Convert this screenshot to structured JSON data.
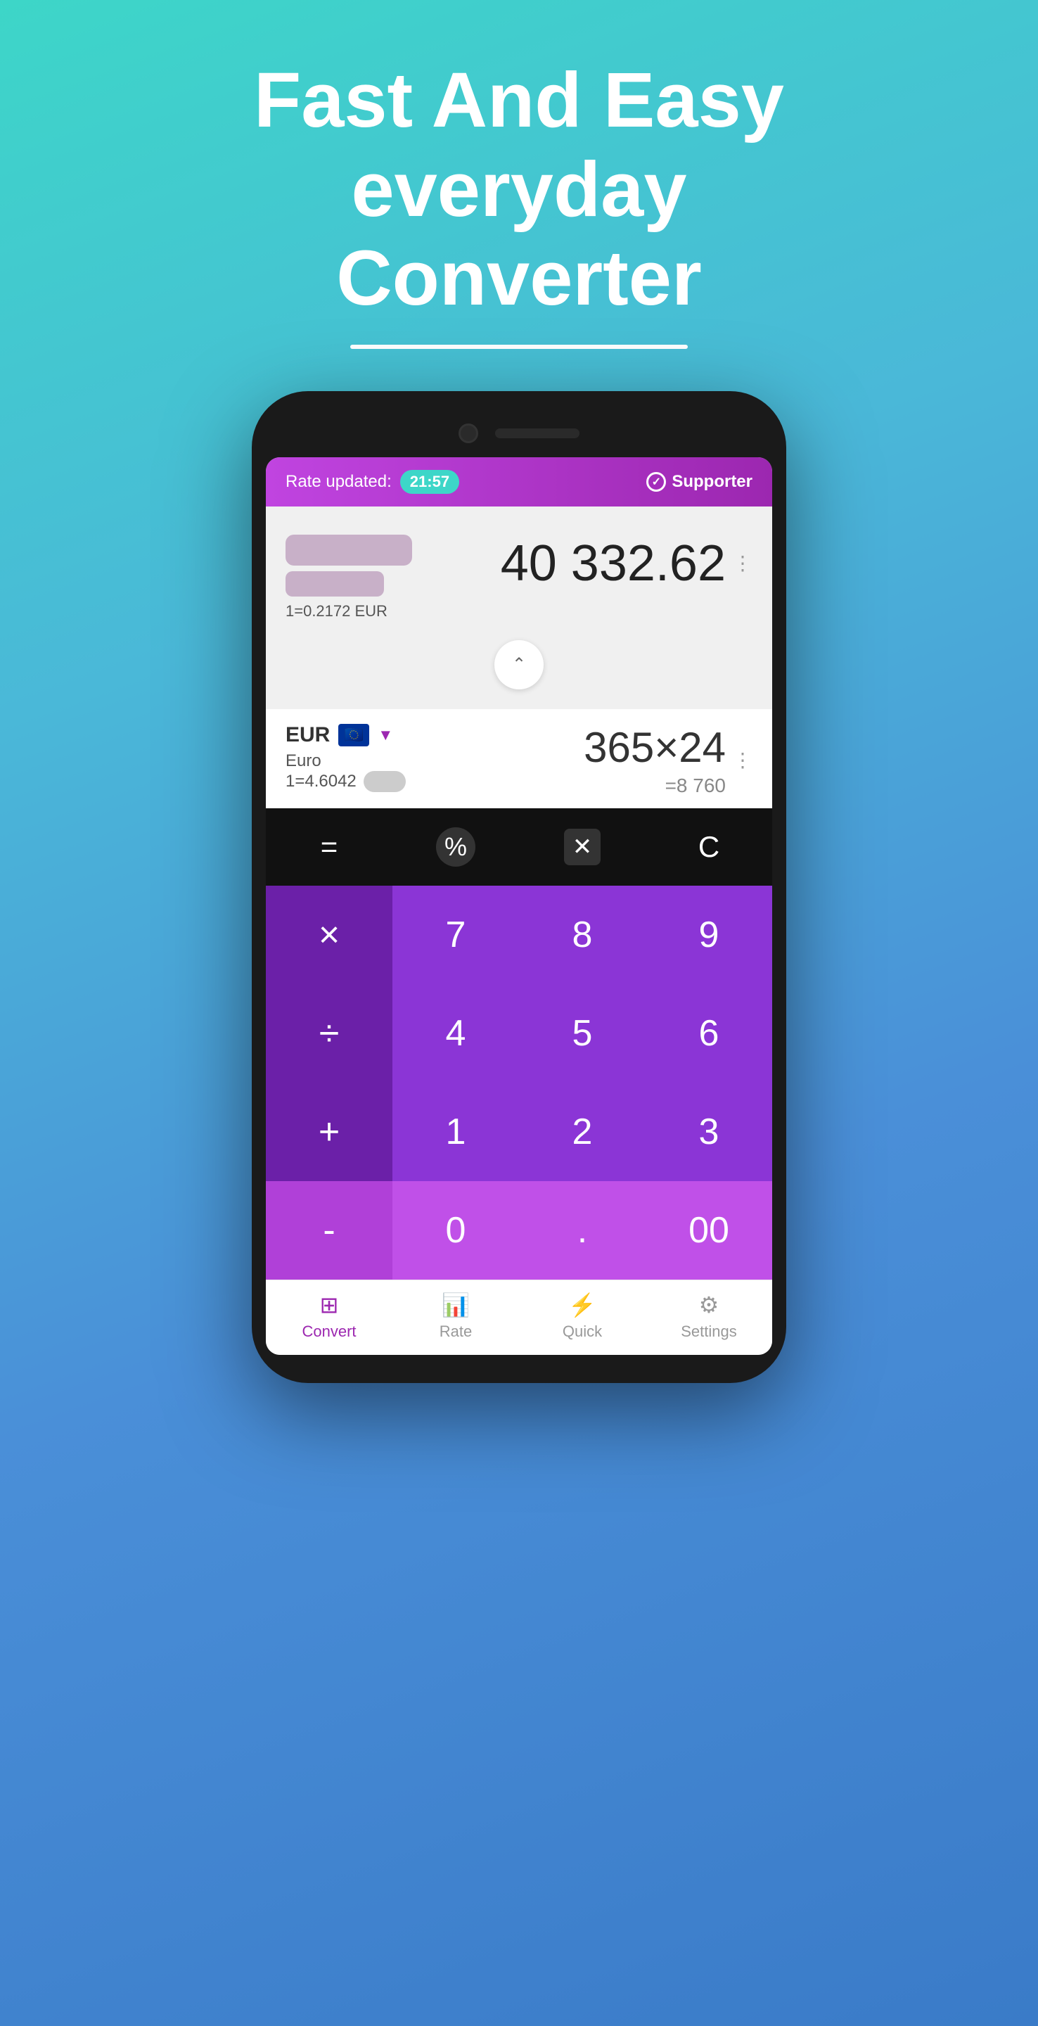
{
  "hero": {
    "line1": "Fast And Easy",
    "line2": "everyday",
    "line3": "Converter"
  },
  "header": {
    "rate_label": "Rate updated:",
    "rate_time": "21:57",
    "supporter_label": "Supporter"
  },
  "top_currency": {
    "exchange_rate": "1=0.2172 EUR",
    "amount": "40 332.62"
  },
  "bottom_currency": {
    "code": "EUR",
    "name": "Euro",
    "rate": "1=4.6042",
    "expression": "365×24",
    "result": "=8 760"
  },
  "keypad": {
    "special_keys": [
      "=",
      "%",
      "⌫",
      "C"
    ],
    "rows": [
      [
        "×",
        "7",
        "8",
        "9"
      ],
      [
        "÷",
        "4",
        "5",
        "6"
      ],
      [
        "+",
        "1",
        "2",
        "3"
      ],
      [
        "-",
        "0",
        ".",
        "00"
      ]
    ]
  },
  "bottom_nav": {
    "items": [
      {
        "id": "convert",
        "label": "Convert",
        "active": true
      },
      {
        "id": "rate",
        "label": "Rate",
        "active": false
      },
      {
        "id": "quick",
        "label": "Quick",
        "active": false
      },
      {
        "id": "settings",
        "label": "Settings",
        "active": false
      }
    ]
  }
}
